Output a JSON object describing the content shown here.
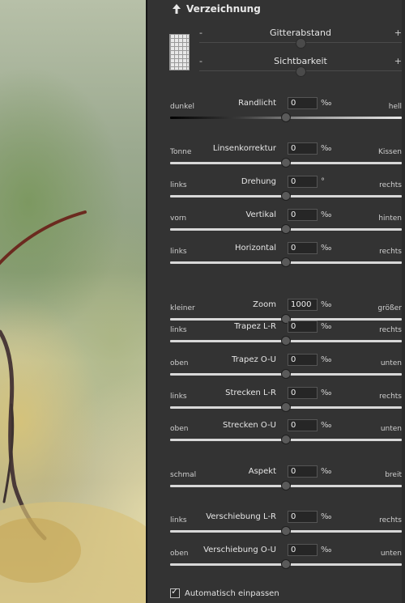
{
  "panel": {
    "section_title": "Verzeichnung",
    "grid_controls": [
      {
        "label": "Gitterabstand",
        "minus": "-",
        "plus": "+",
        "position": 0.5
      },
      {
        "label": "Sichtbarkeit",
        "minus": "-",
        "plus": "+",
        "position": 0.5
      }
    ],
    "sliders": [
      {
        "left": "dunkel",
        "name": "Randlicht",
        "value": "0",
        "unit": "‰",
        "right": "hell",
        "position": 0.5,
        "gradient": true
      },
      {
        "left": "Tonne",
        "name": "Linsenkorrektur",
        "value": "0",
        "unit": "‰",
        "right": "Kissen",
        "position": 0.5
      },
      {
        "left": "links",
        "name": "Drehung",
        "value": "0",
        "unit": "°",
        "right": "rechts",
        "position": 0.5
      },
      {
        "left": "vorn",
        "name": "Vertikal",
        "value": "0",
        "unit": "‰",
        "right": "hinten",
        "position": 0.5
      },
      {
        "left": "links",
        "name": "Horizontal",
        "value": "0",
        "unit": "‰",
        "right": "rechts",
        "position": 0.5
      },
      {
        "left": "kleiner",
        "name": "Zoom",
        "value": "1000",
        "unit": "‰",
        "right": "größer",
        "position": 0.5
      },
      {
        "left": "links",
        "name": "Trapez L-R",
        "value": "0",
        "unit": "‰",
        "right": "rechts",
        "position": 0.5
      },
      {
        "left": "oben",
        "name": "Trapez O-U",
        "value": "0",
        "unit": "‰",
        "right": "unten",
        "position": 0.5
      },
      {
        "left": "links",
        "name": "Strecken L-R",
        "value": "0",
        "unit": "‰",
        "right": "rechts",
        "position": 0.5
      },
      {
        "left": "oben",
        "name": "Strecken O-U",
        "value": "0",
        "unit": "‰",
        "right": "unten",
        "position": 0.5
      },
      {
        "left": "schmal",
        "name": "Aspekt",
        "value": "0",
        "unit": "‰",
        "right": "breit",
        "position": 0.5
      },
      {
        "left": "links",
        "name": "Verschiebung L-R",
        "value": "0",
        "unit": "‰",
        "right": "rechts",
        "position": 0.5
      },
      {
        "left": "oben",
        "name": "Verschiebung O-U",
        "value": "0",
        "unit": "‰",
        "right": "unten",
        "position": 0.5
      }
    ],
    "auto_fit": {
      "label": "Automatisch einpassen",
      "checked": true
    }
  },
  "icons": {
    "collapse": "arrow-up-icon",
    "grid": "grid-icon",
    "check": "checkmark-icon"
  },
  "colors": {
    "panel_bg": "#333333",
    "track": "#d8d8d8",
    "thumb": "#5a5a5a"
  }
}
